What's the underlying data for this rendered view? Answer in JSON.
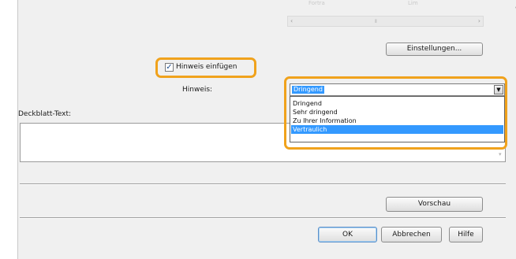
{
  "header_faint": {
    "left": "Fortra",
    "right": "Lim"
  },
  "scrollbar": {
    "left_arrow": "‹",
    "right_arrow": "›",
    "thumb": "⦀"
  },
  "buttons": {
    "settings": "Einstellungen...",
    "preview": "Vorschau",
    "ok": "OK",
    "cancel": "Abbrechen",
    "help": "Hilfe"
  },
  "insert_note": {
    "label": "Hinweis einfügen",
    "checked": true,
    "check_glyph": "✓"
  },
  "note": {
    "label": "Hinweis:",
    "selected": "Dringend",
    "options": [
      "Dringend",
      "Sehr dringend",
      "Zu Ihrer Information",
      "Vertraulich"
    ],
    "highlighted_option": "Vertraulich",
    "dropdown_arrow": "▼"
  },
  "cover_text": {
    "label": "Deckblatt-Text:",
    "value": ""
  },
  "colors": {
    "highlight_ring": "#f0a21c",
    "selection": "#3399ff"
  }
}
